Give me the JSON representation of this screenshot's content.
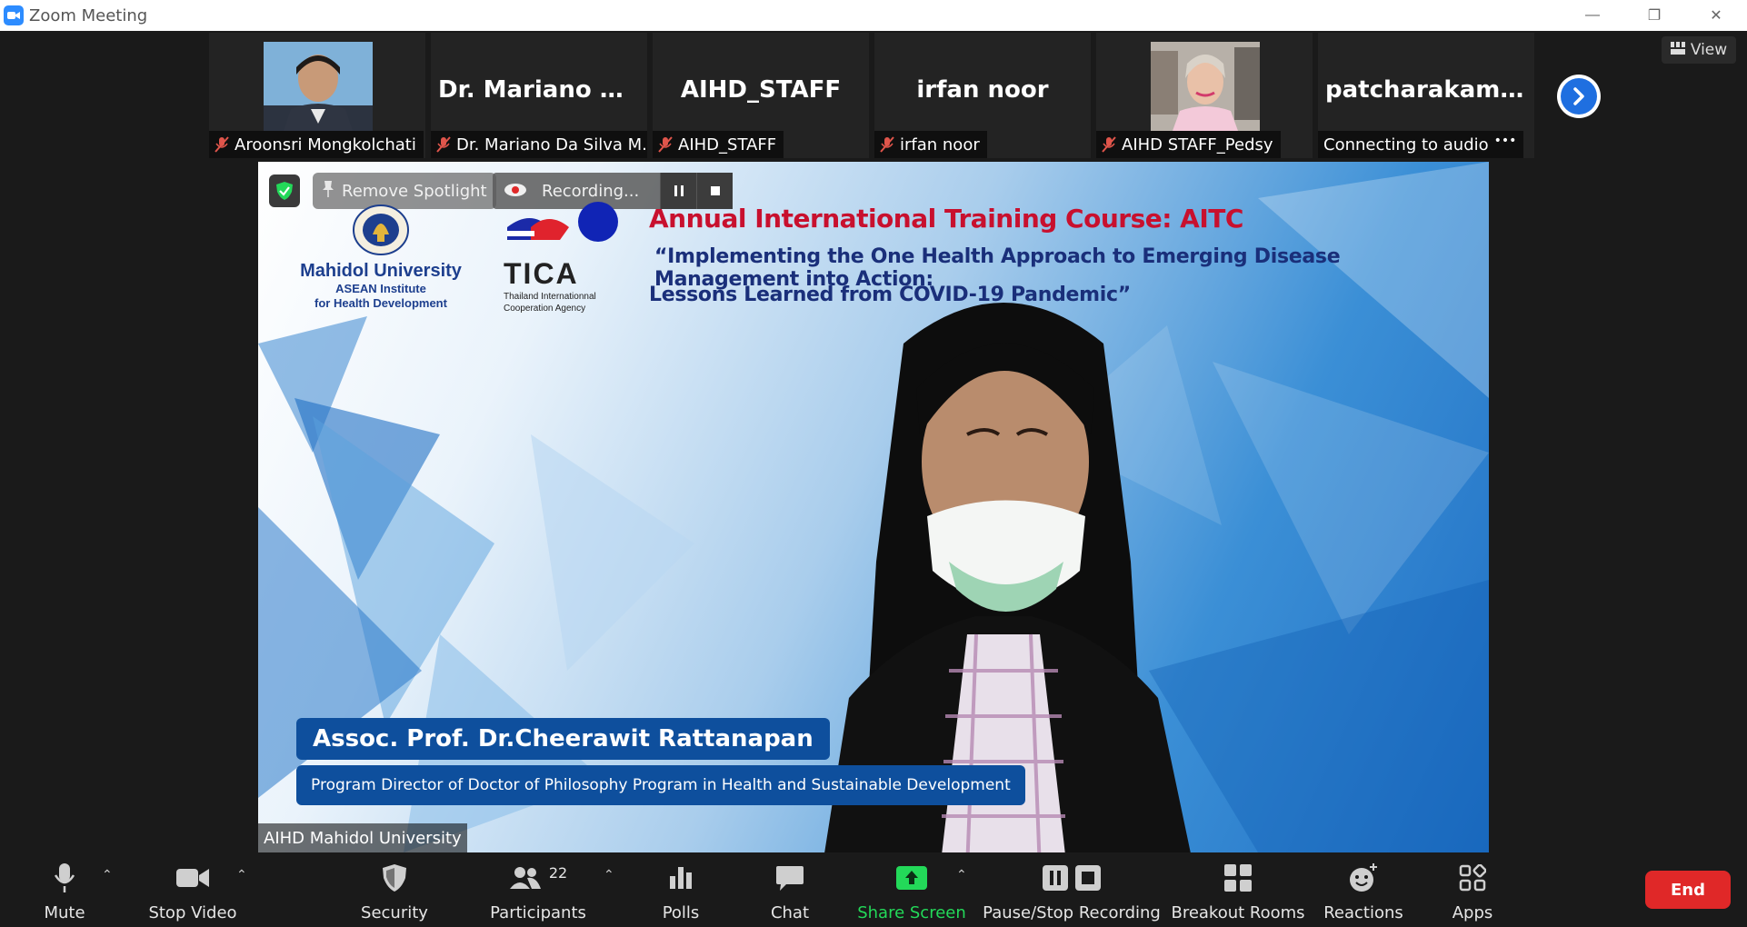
{
  "window": {
    "title": "Zoom Meeting"
  },
  "thumbnails": [
    {
      "big_name": "",
      "label": "Aroonsri Mongkolchati",
      "has_photo": true
    },
    {
      "big_name": "Dr. Mariano Da...",
      "label": "Dr. Mariano Da Silva M..."
    },
    {
      "big_name": "AIHD_STAFF",
      "label": "AIHD_STAFF"
    },
    {
      "big_name": "irfan noor",
      "label": "irfan noor"
    },
    {
      "big_name": "",
      "label": "AIHD STAFF_Pedsy",
      "has_photo": true
    },
    {
      "big_name": "patcharakamon...",
      "label": "Connecting to audio"
    }
  ],
  "view_button": {
    "label": "View"
  },
  "speaker": {
    "remove_spotlight": "Remove Spotlight",
    "recording_label": "Recording...",
    "logo_mu_name": "Mahidol University",
    "logo_mu_sub1": "ASEAN Institute",
    "logo_mu_sub2": "for Health Development",
    "logo_tica": "TICA",
    "logo_tica_sub1": "Thailand Internationnal",
    "logo_tica_sub2": "Cooperation Agency",
    "course_title": "Annual International Training Course: AITC",
    "course_line1": "“Implementing the One Health Approach to Emerging Disease Management into Action:",
    "course_line2": "Lessons Learned from COVID-19 Pandemic”",
    "presenter_name": "Assoc. Prof. Dr.Cheerawit Rattanapan",
    "presenter_role": "Program Director of Doctor of Philosophy Program in Health and Sustainable Development",
    "video_label": "AIHD Mahidol University"
  },
  "toolbar": {
    "mute": "Mute",
    "stop_video": "Stop Video",
    "security": "Security",
    "participants": "Participants",
    "participants_count": "22",
    "polls": "Polls",
    "chat": "Chat",
    "share_screen": "Share Screen",
    "pause_stop_recording": "Pause/Stop Recording",
    "breakout_rooms": "Breakout Rooms",
    "reactions": "Reactions",
    "apps": "Apps",
    "end": "End"
  },
  "colors": {
    "share_green": "#23d959",
    "end_red": "#e02828",
    "accent_blue": "#1f6fe0"
  }
}
